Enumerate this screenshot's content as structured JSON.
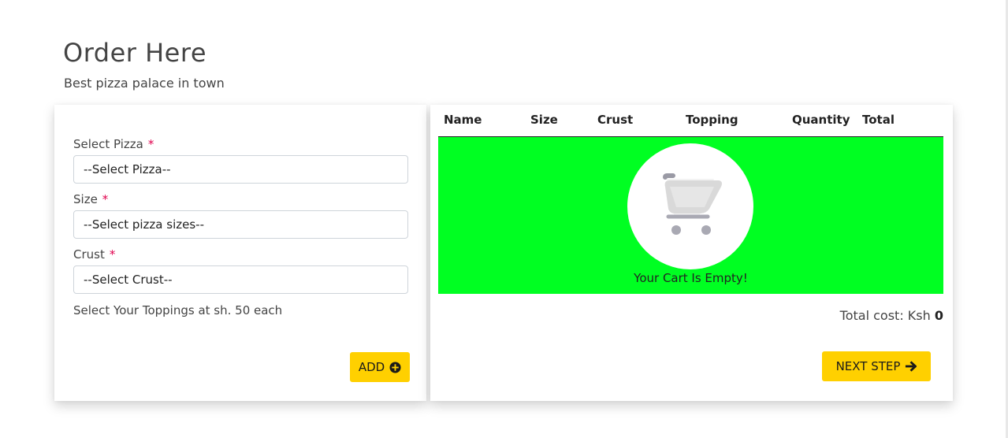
{
  "page": {
    "title": "Order Here",
    "subtitle": "Best pizza palace in town"
  },
  "form": {
    "pizza_label": "Select Pizza",
    "pizza_value": "--Select Pizza--",
    "size_label": "Size",
    "size_value": "--Select pizza sizes--",
    "crust_label": "Crust",
    "crust_value": "--Select Crust--",
    "required_mark": "*",
    "toppings_label": "Select Your Toppings at sh. 50 each",
    "add_label": "ADD"
  },
  "cart": {
    "columns": [
      "Name",
      "Size",
      "Crust",
      "Topping",
      "Quantity",
      "Total"
    ],
    "empty_text": "Your Cart Is Empty!",
    "total_label": "Total cost: Ksh",
    "total_value": "0",
    "next_label": "NEXT STEP"
  },
  "colors": {
    "accent_yellow": "#ffd000",
    "empty_bg": "#00ff22",
    "required": "#e0004d"
  },
  "icons": {
    "add": "plus-circle-icon",
    "next": "arrow-right-icon",
    "cart": "shopping-cart-icon"
  }
}
